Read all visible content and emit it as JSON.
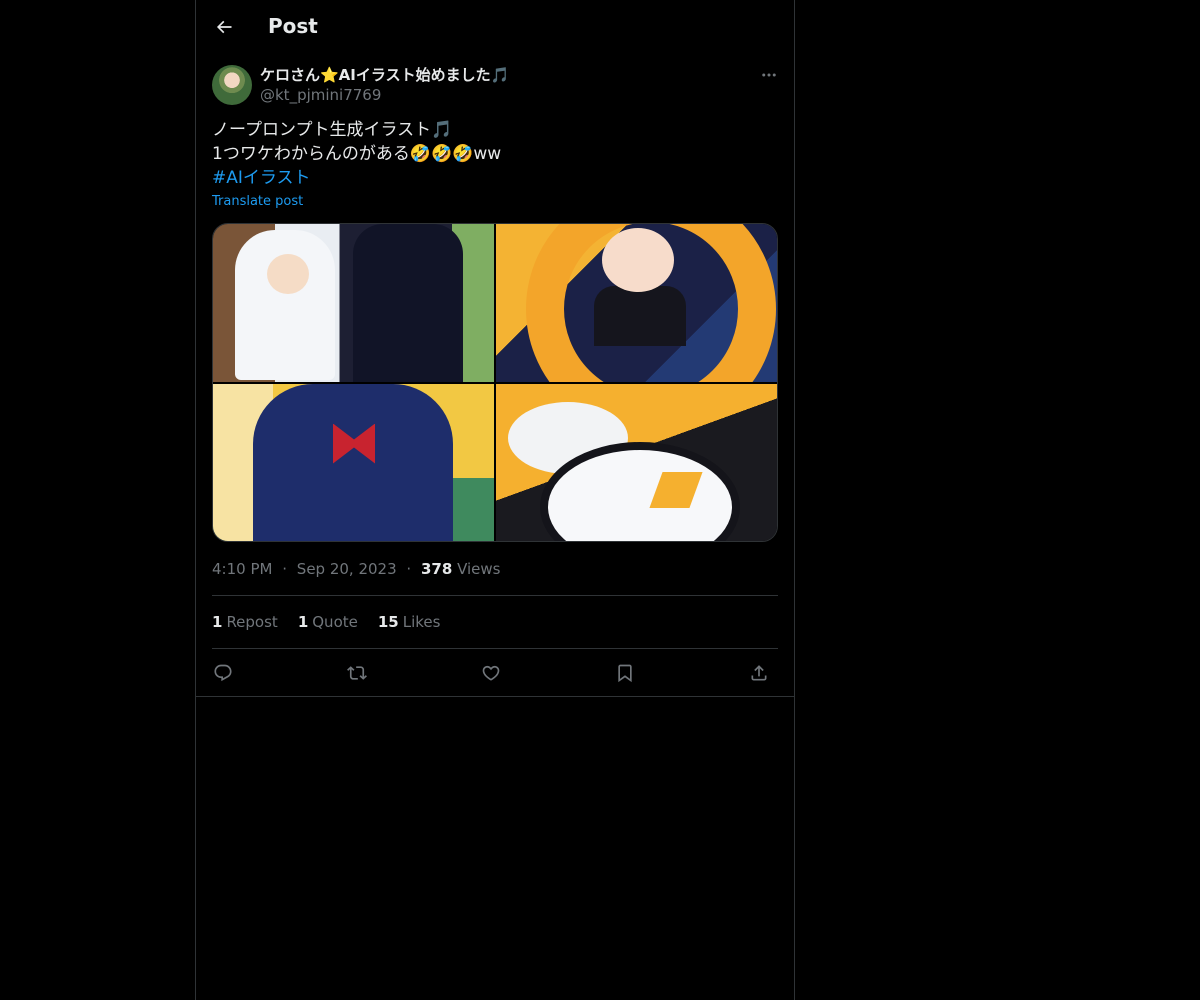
{
  "header": {
    "title": "Post",
    "back_icon": "arrow-left-icon"
  },
  "author": {
    "display_name": "ケロさん⭐AIイラスト始めました🎵",
    "handle": "@kt_pjmini7769",
    "more_icon": "more-horizontal-icon"
  },
  "post": {
    "line1": "ノープロンプト生成イラスト🎵",
    "line2": "1つワケわからんのがある🤣🤣🤣ww",
    "hashtag": "#AIイラスト",
    "translate_label": "Translate post"
  },
  "media": {
    "count": 4
  },
  "meta": {
    "time": "4:10 PM",
    "date": "Sep 20, 2023",
    "separator": "·",
    "views_count": "378",
    "views_label": "Views"
  },
  "stats": {
    "reposts_count": "1",
    "reposts_label": "Repost",
    "quotes_count": "1",
    "quotes_label": "Quote",
    "likes_count": "15",
    "likes_label": "Likes"
  },
  "actions": [
    "reply-icon",
    "repost-icon",
    "like-icon",
    "bookmark-icon",
    "share-icon"
  ],
  "colors": {
    "background": "#000000",
    "text": "#e7e9ea",
    "muted": "#71767b",
    "link": "#1d9bf0",
    "border": "#2f3336"
  }
}
